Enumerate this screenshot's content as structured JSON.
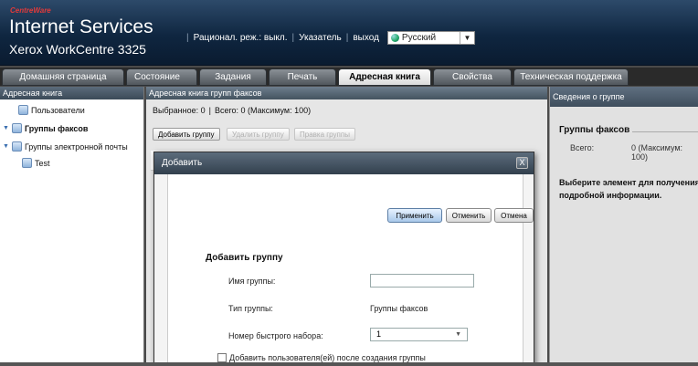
{
  "header": {
    "logo_text": "CentreWare",
    "title": "Internet Services",
    "subtitle": "Xerox WorkCentre 3325",
    "link_energy": "Рационал. реж.: выкл.",
    "link_index": "Указатель",
    "link_logout": "выход",
    "language": "Русский"
  },
  "tabs": [
    {
      "label": "Домашняя страница"
    },
    {
      "label": "Состояние"
    },
    {
      "label": "Задания"
    },
    {
      "label": "Печать"
    },
    {
      "label": "Адресная книга"
    },
    {
      "label": "Свойства"
    },
    {
      "label": "Техническая поддержка"
    }
  ],
  "sidebar": {
    "title": "Адресная книга",
    "items": [
      {
        "label": "Пользователи"
      },
      {
        "label": "Группы факсов"
      },
      {
        "label": "Группы электронной почты"
      },
      {
        "label": "Test"
      }
    ]
  },
  "main": {
    "title": "Адресная книга групп факсов",
    "selected": "Выбранное: 0",
    "total": "Всего: 0 (Максимум: 100)",
    "btn_add": "Добавить группу",
    "btn_delete": "Удалить группу",
    "btn_edit": "Правка группы"
  },
  "dialog": {
    "title": "Добавить",
    "close": "X",
    "btn_apply": "Применить",
    "btn_undo": "Отменить",
    "btn_cancel": "Отмена",
    "section": "Добавить группу",
    "label_name": "Имя группы:",
    "name_value": "",
    "label_type": "Тип группы:",
    "type_value": "Группы факсов",
    "label_speed": "Номер быстрого набора:",
    "speed_value": "1",
    "checkbox_label": "Добавить пользователя(ей) после создания группы"
  },
  "details": {
    "title": "Сведения о группе",
    "group_title": "Группы факсов",
    "total_label": "Всего:",
    "total_value": "0 (Максимум: 100)",
    "info": "Выберите элемент для получения подробной информации."
  }
}
